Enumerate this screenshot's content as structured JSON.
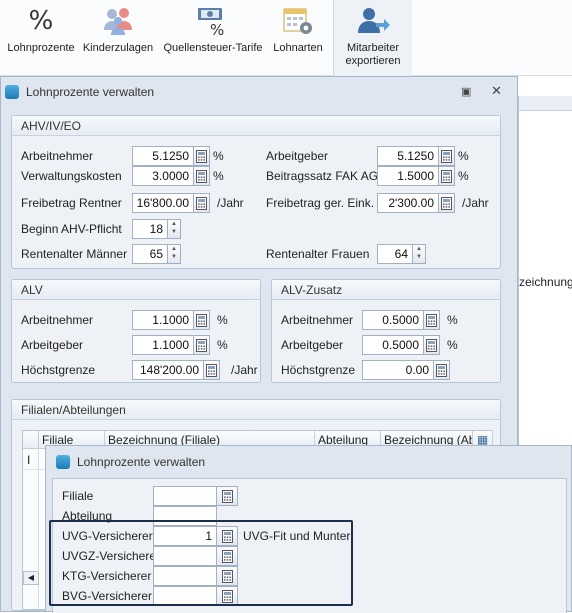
{
  "ribbon": {
    "items": [
      {
        "label": "Lohnprozente",
        "icon": "percent-icon"
      },
      {
        "label": "Kinderzulagen",
        "icon": "family-icon"
      },
      {
        "label": "Quellensteuer-Tarife",
        "icon": "money-percent-icon"
      },
      {
        "label": "Lohnarten",
        "icon": "calendar-gear-icon"
      },
      {
        "label": "Mitarbeiter exportieren",
        "icon": "user-export-icon"
      }
    ]
  },
  "background": {
    "col_header": "zeichnung)"
  },
  "dialog1": {
    "title": "Lohnprozente verwalten",
    "ahv": {
      "title": "AHV/IV/EO",
      "arbeitnehmer": {
        "label": "Arbeitnehmer",
        "value": "5.1250",
        "unit": "%"
      },
      "verwaltung": {
        "label": "Verwaltungskosten",
        "value": "3.0000",
        "unit": "%"
      },
      "freibetrag_rentner": {
        "label": "Freibetrag Rentner",
        "value": "16'800.00",
        "unit": "/Jahr"
      },
      "beginn": {
        "label": "Beginn AHV-Pflicht",
        "value": "18"
      },
      "rentenalter_m": {
        "label": "Rentenalter Männer",
        "value": "65"
      },
      "arbeitgeber": {
        "label": "Arbeitgeber",
        "value": "5.1250",
        "unit": "%"
      },
      "beitragssatz": {
        "label": "Beitragssatz FAK AG",
        "value": "1.5000",
        "unit": "%"
      },
      "freibetrag_ger": {
        "label": "Freibetrag ger. Eink.",
        "value": "2'300.00",
        "unit": "/Jahr"
      },
      "rentenalter_f": {
        "label": "Rentenalter Frauen",
        "value": "64"
      }
    },
    "alv": {
      "title": "ALV",
      "arbeitnehmer": {
        "label": "Arbeitnehmer",
        "value": "1.1000",
        "unit": "%"
      },
      "arbeitgeber": {
        "label": "Arbeitgeber",
        "value": "1.1000",
        "unit": "%"
      },
      "hoechstgrenze": {
        "label": "Höchstgrenze",
        "value": "148'200.00",
        "unit": "/Jahr"
      }
    },
    "alvz": {
      "title": "ALV-Zusatz",
      "arbeitnehmer": {
        "label": "Arbeitnehmer",
        "value": "0.5000",
        "unit": "%"
      },
      "arbeitgeber": {
        "label": "Arbeitgeber",
        "value": "0.5000",
        "unit": "%"
      },
      "hoechstgrenze": {
        "label": "Höchstgrenze",
        "value": "0.00"
      }
    },
    "filialen": {
      "title": "Filialen/Abteilungen",
      "columns": [
        "Filiale",
        "Bezeichnung (Filiale)",
        "Abteilung",
        "Bezeichnung (Abte"
      ],
      "row_marker": "I"
    }
  },
  "dialog2": {
    "title": "Lohnprozente verwalten",
    "filiale_label": "Filiale",
    "abteilung_label": "Abteilung",
    "uvg": {
      "label": "UVG-Versicherer",
      "value": "1",
      "description": "UVG-Fit und Munter"
    },
    "uvgz_label": "UVGZ-Versicherer",
    "ktg_label": "KTG-Versicherer",
    "bvg_label": "BVG-Versicherer"
  },
  "colors": {
    "accent": "#1b7ab5",
    "highlight_border": "#1d2f4d",
    "panel": "#eef2f7"
  }
}
